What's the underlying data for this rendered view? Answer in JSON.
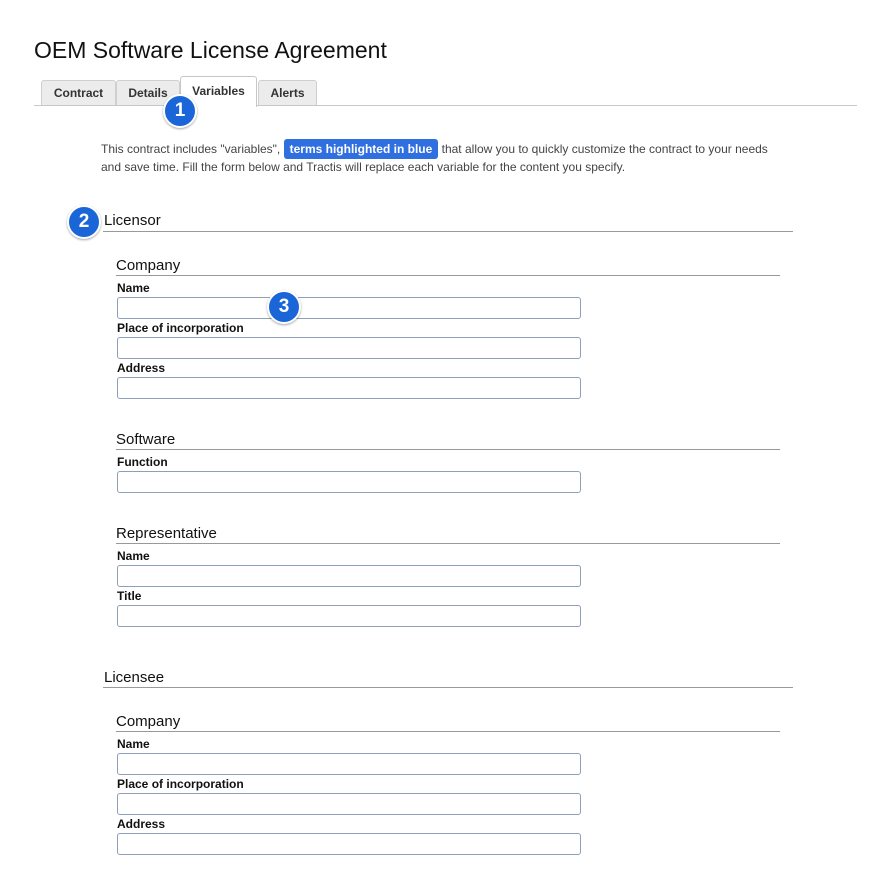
{
  "page": {
    "title": "OEM Software License Agreement"
  },
  "tabs": [
    {
      "label": "Contract"
    },
    {
      "label": "Details"
    },
    {
      "label": "Variables",
      "active": true
    },
    {
      "label": "Alerts"
    }
  ],
  "callouts": [
    "1",
    "2",
    "3"
  ],
  "intro": {
    "before": "This contract includes \"variables\",",
    "highlight": "terms highlighted in blue",
    "after": "that allow you to quickly customize the contract to your needs and save time. Fill the form below and Tractis will replace each variable for the content you specify."
  },
  "licensor": {
    "heading": "Licensor",
    "company": {
      "heading": "Company",
      "name": {
        "label": "Name",
        "value": ""
      },
      "place": {
        "label": "Place of incorporation",
        "value": ""
      },
      "address": {
        "label": "Address",
        "value": ""
      }
    },
    "software": {
      "heading": "Software",
      "function": {
        "label": "Function",
        "value": ""
      }
    },
    "representative": {
      "heading": "Representative",
      "name": {
        "label": "Name",
        "value": ""
      },
      "title": {
        "label": "Title",
        "value": ""
      }
    }
  },
  "licensee": {
    "heading": "Licensee",
    "company": {
      "heading": "Company",
      "name": {
        "label": "Name",
        "value": ""
      },
      "place": {
        "label": "Place of incorporation",
        "value": ""
      },
      "address": {
        "label": "Address",
        "value": ""
      }
    }
  },
  "colors": {
    "accent": "#2f6fe0",
    "badge": "#1a66d8"
  }
}
